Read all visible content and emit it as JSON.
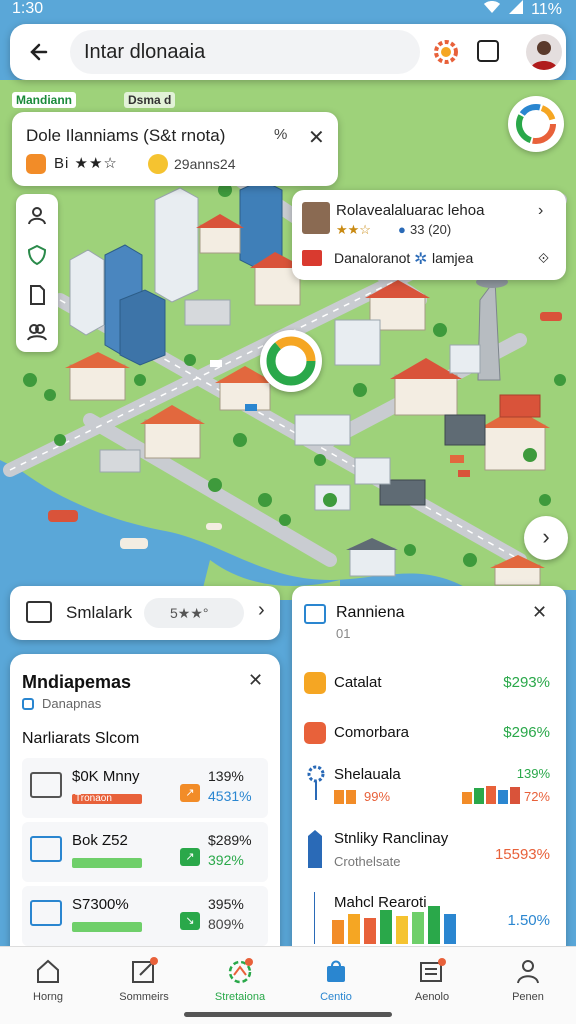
{
  "status_bar": {
    "time": "1:30",
    "battery": "11%"
  },
  "search": {
    "value": "Intar dlonaaia"
  },
  "map_labels": {
    "label_green": "Mandiann",
    "label_dark": "Dsma d"
  },
  "info_card": {
    "title": "Dole Ilanniams (S&t rnota)",
    "percent": "%",
    "close": "✕",
    "stars": "Bi ★★☆",
    "sub": "29anns24"
  },
  "place_card": {
    "name": "Rolavealaluarac lehoa",
    "chevron": "›",
    "stars": "★★☆",
    "mini": "●",
    "meta": "33 (20)",
    "line_a": "Danaloranot",
    "gear": "✲",
    "line_b": "lamjea",
    "chevron2": "⟐"
  },
  "filter_card": {
    "label": "Smlalark",
    "pill_value": "5★★°",
    "arrow": "›"
  },
  "left_panel": {
    "title": "Mndiapemas",
    "close": "✕",
    "subtitle": "Danapnas",
    "section": "Narliarats Slcom",
    "rows": [
      {
        "title": "$0K Mnny",
        "bar": "Tronaon",
        "bar_color": "#e8613a",
        "sq_color": "#f28c28",
        "v1": "139%",
        "v2": "4531%",
        "v2_color": "#2a86d0"
      },
      {
        "title": "Bok Z52",
        "bar": "",
        "bar_color": "#6fcf6a",
        "sq_color": "#2aa84a",
        "v1": "$289%",
        "v2": "392%",
        "v2_color": "#2aa84a"
      },
      {
        "title": "S7300%",
        "bar": "",
        "bar_color": "#6fcf6a",
        "sq_color": "#2aa84a",
        "v1": "395%",
        "v2": "809%",
        "v2_color": "#444"
      }
    ]
  },
  "right_panel": {
    "title": "Ranniena",
    "subtitle": "01",
    "close": "✕",
    "rows": [
      {
        "title": "Catalat",
        "value": "$293%",
        "icon_color": "#f5a623",
        "value_color": "#2aa84a"
      },
      {
        "title": "Comorbara",
        "value": "$296%",
        "icon_color": "#e8613a",
        "value_color": "#2aa84a"
      }
    ],
    "row3": {
      "title": "Shelauala",
      "left_val": "99%",
      "right_top": "139%",
      "right_val": "72%"
    },
    "row4": {
      "title": "Stnliky Ranclinay",
      "subtitle": "Crothelsate",
      "value": "15593%"
    },
    "row5": {
      "title": "Mahcl Rearoti",
      "value": "1.50%"
    }
  },
  "bottom_nav": [
    {
      "label": "Horng",
      "icon": "home-icon",
      "active": false
    },
    {
      "label": "Sommeirs",
      "icon": "compose-icon",
      "active": false
    },
    {
      "label": "Stretaiona",
      "icon": "route-icon",
      "active": true
    },
    {
      "label": "Centio",
      "icon": "bag-icon",
      "active": false
    },
    {
      "label": "Aenolo",
      "icon": "news-icon",
      "active": false
    },
    {
      "label": "Penen",
      "icon": "person-icon",
      "active": false
    }
  ],
  "colors": {
    "accent_blue": "#2a86d0",
    "accent_green": "#2aa84a",
    "accent_orange": "#f28c28",
    "water": "#5aa7d8",
    "land": "#9ed27a"
  }
}
